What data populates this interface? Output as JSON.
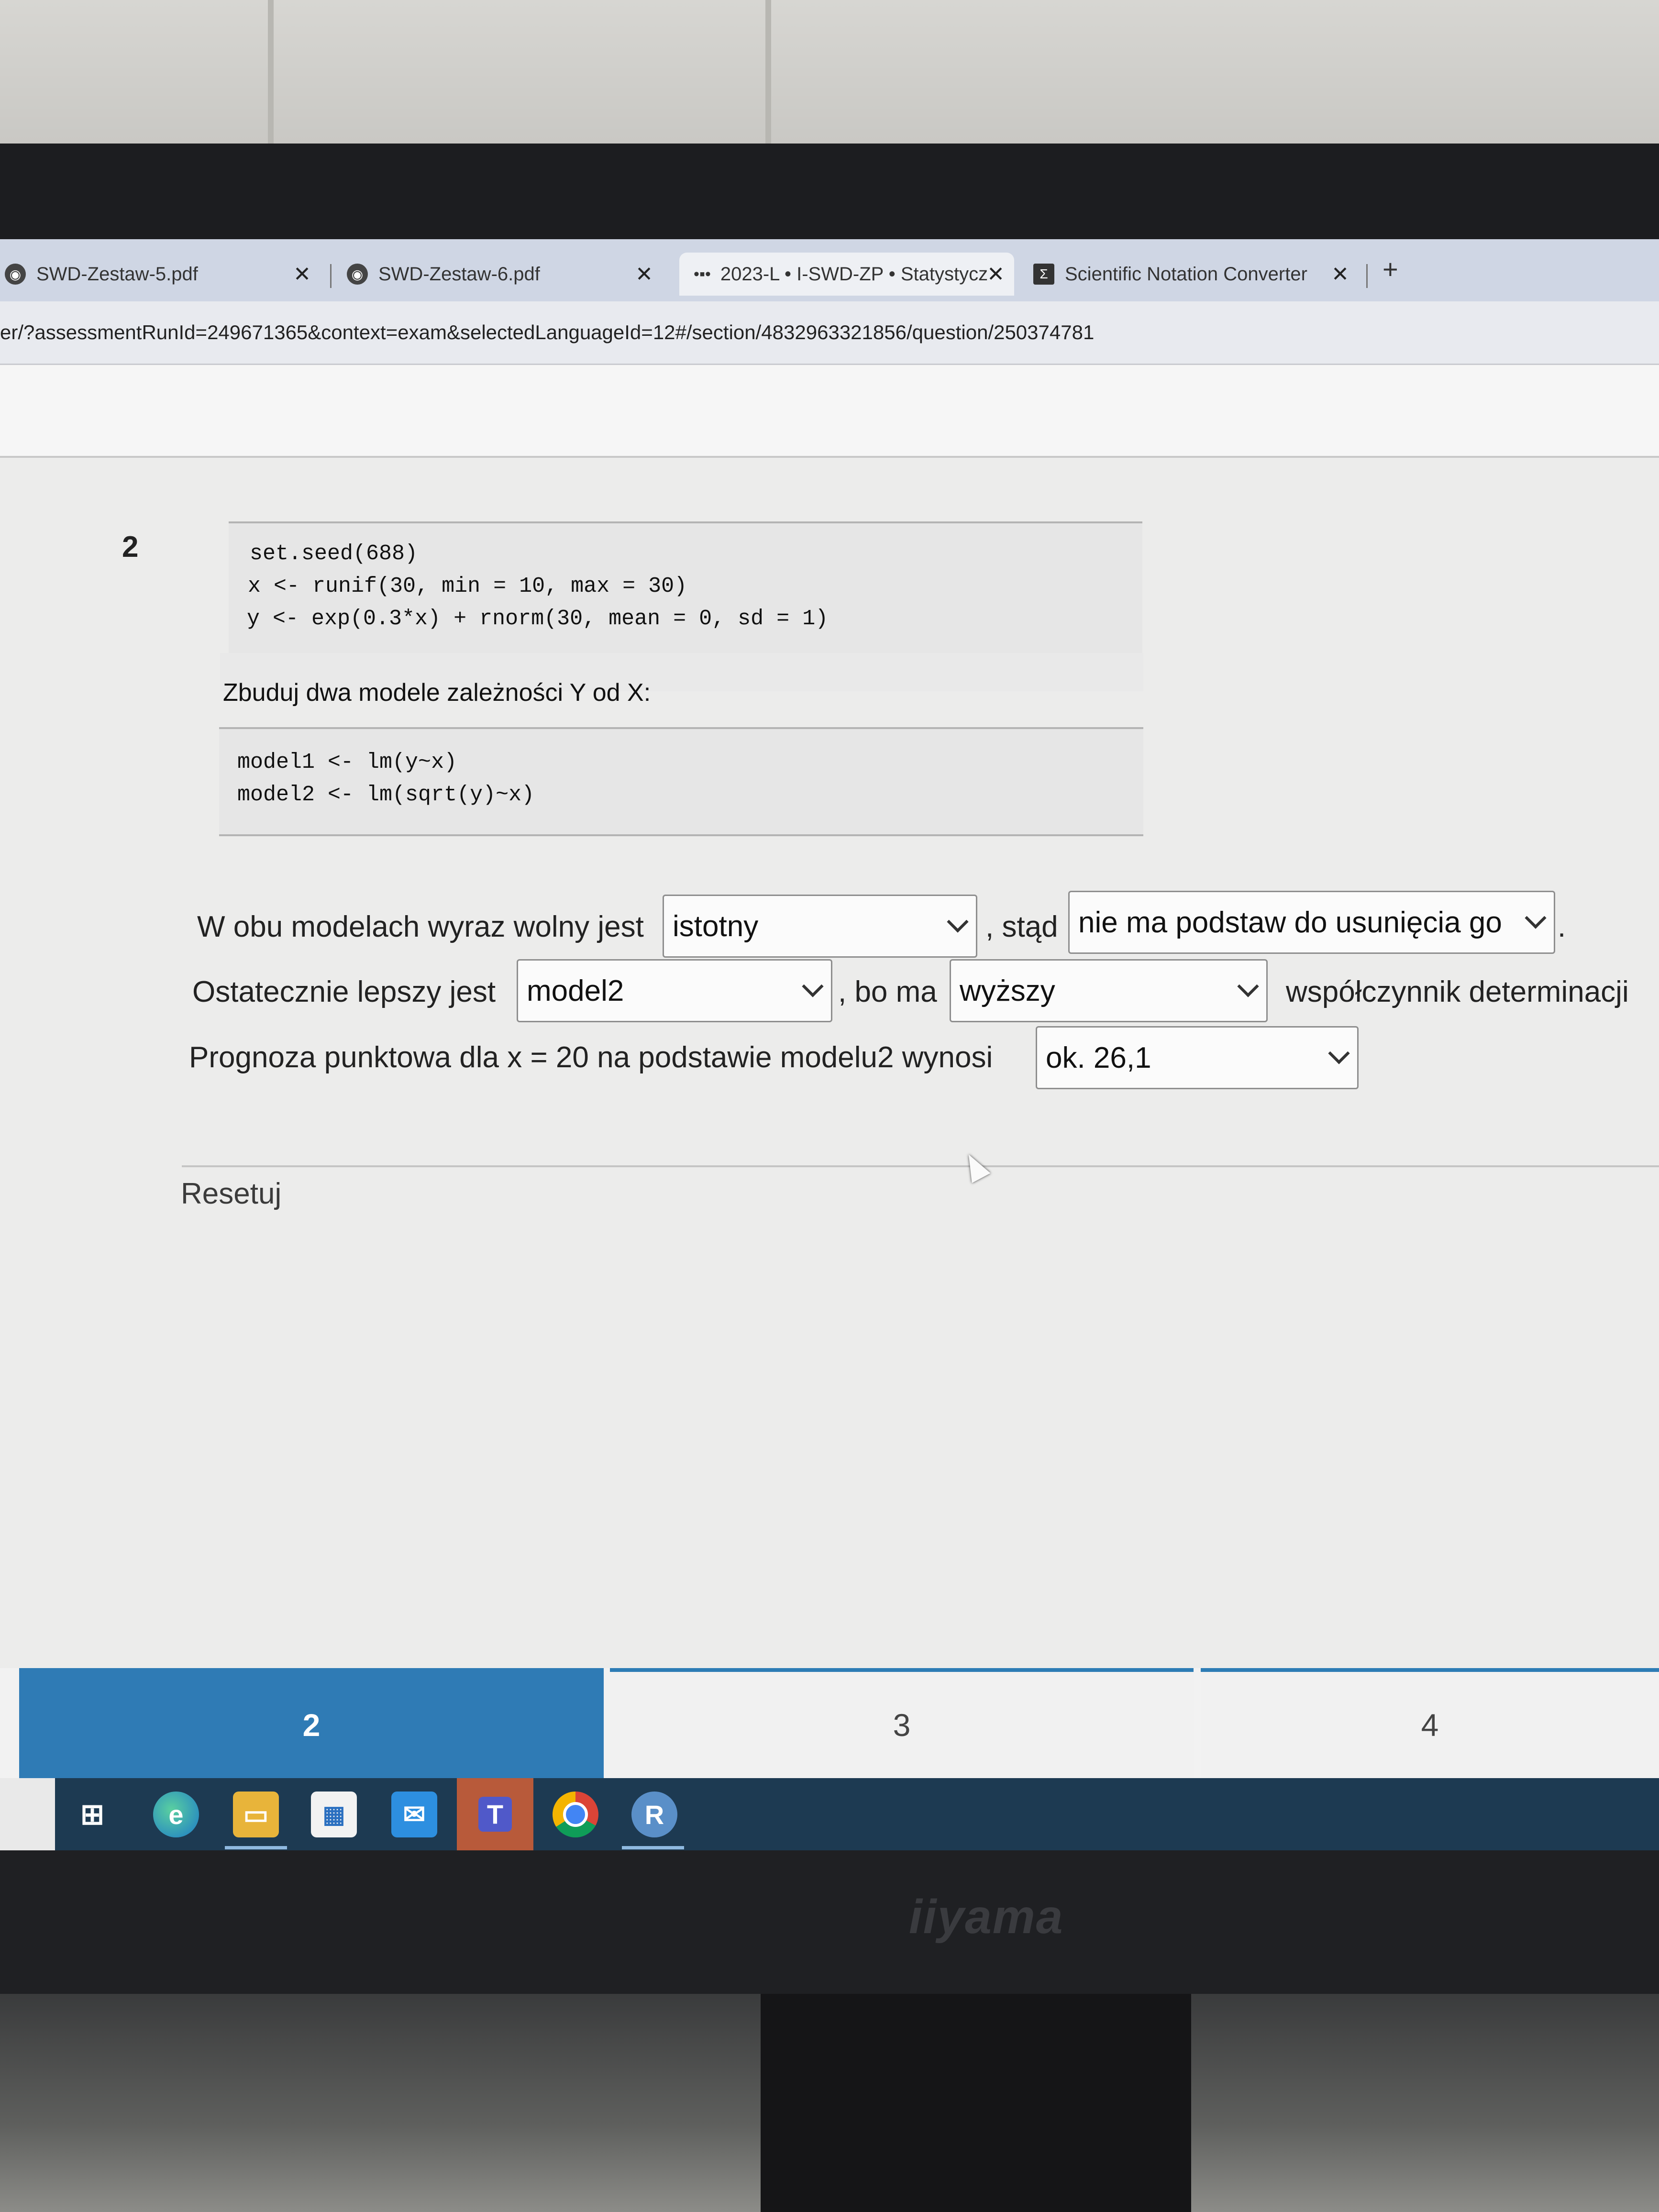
{
  "browser": {
    "tabs": [
      {
        "title": "SWD-Zestaw-5.pdf",
        "close": "✕"
      },
      {
        "title": "SWD-Zestaw-6.pdf",
        "close": "✕"
      },
      {
        "title": "2023-L • I-SWD-ZP • Statystycz",
        "close": "✕"
      },
      {
        "title": "Scientific Notation Converter",
        "close": "✕"
      }
    ],
    "new_tab": "+",
    "url": "er/?assessmentRunId=249671365&context=exam&selectedLanguageId=12#/section/4832963321856/question/250374781"
  },
  "question": {
    "number": "2",
    "code1": [
      "set.seed(688)",
      "x <- runif(30, min = 10, max = 30)",
      "y <- exp(0.3*x) + rnorm(30, mean = 0, sd = 1)"
    ],
    "prompt": "Zbuduj dwa modele zależności Y od X:",
    "code2": [
      "model1 <- lm(y~x)",
      "model2 <- lm(sqrt(y)~x)"
    ],
    "line1": {
      "pre": "W obu modelach wyraz wolny jest",
      "dd1": "istotny",
      "mid": ", stąd",
      "dd2": "nie ma podstaw do usunięcia go",
      "post": "."
    },
    "line2": {
      "pre": "Ostatecznie lepszy jest",
      "dd1": "model2",
      "mid": ", bo ma",
      "dd2": "wyższy",
      "post": "współczynnik determinacji"
    },
    "line3": {
      "pre": "Prognoza punktowa dla x = 20 na podstawie modelu2 wynosi",
      "dd1": "ok. 26,1"
    },
    "reset": "Resetuj"
  },
  "pager": {
    "pages": [
      "2",
      "3",
      "4"
    ],
    "active": "2"
  },
  "taskbar": {
    "r_label": "R",
    "teams_label": "T"
  },
  "monitor": {
    "brand": "iiyama"
  }
}
